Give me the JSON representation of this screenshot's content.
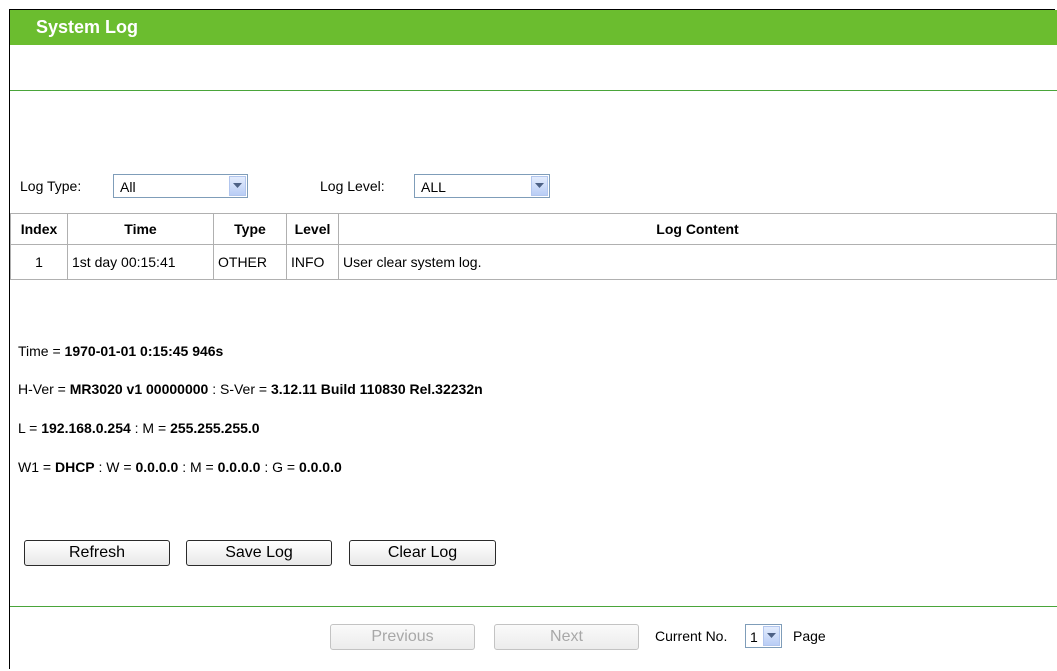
{
  "page_title": "System Log",
  "filters": {
    "log_type_label": "Log Type:",
    "log_type_value": "All",
    "log_level_label": "Log Level:",
    "log_level_value": "ALL"
  },
  "table": {
    "headers": [
      "Index",
      "Time",
      "Type",
      "Level",
      "Log Content"
    ],
    "rows": [
      {
        "index": "1",
        "time": "1st day 00:15:41",
        "type": "OTHER",
        "level": "INFO",
        "content": "User clear system log."
      }
    ]
  },
  "system_info": {
    "line1": {
      "k1": "Time = ",
      "v1": "1970-01-01 0:15:45 946s"
    },
    "line2": {
      "k1": "H-Ver = ",
      "v1": "MR3020 v1 00000000",
      "k2": " : S-Ver = ",
      "v2": "3.12.11 Build 110830 Rel.32232n"
    },
    "line3": {
      "k1": "L = ",
      "v1": "192.168.0.254",
      "k2": " : M = ",
      "v2": "255.255.255.0"
    },
    "line4": {
      "k1": "W1 = ",
      "v1": "DHCP",
      "k2": " : W = ",
      "v2": "0.0.0.0",
      "k3": " : M = ",
      "v3": "0.0.0.0",
      "k4": " : G = ",
      "v4": "0.0.0.0"
    }
  },
  "buttons": {
    "refresh": "Refresh",
    "save_log": "Save Log",
    "clear_log": "Clear Log",
    "previous": "Previous",
    "next": "Next"
  },
  "pager": {
    "current_label": "Current No.",
    "current_value": "1",
    "page_label": "Page"
  },
  "colors": {
    "title_bar": "#6bbd2f",
    "divider": "#4aa53a"
  }
}
